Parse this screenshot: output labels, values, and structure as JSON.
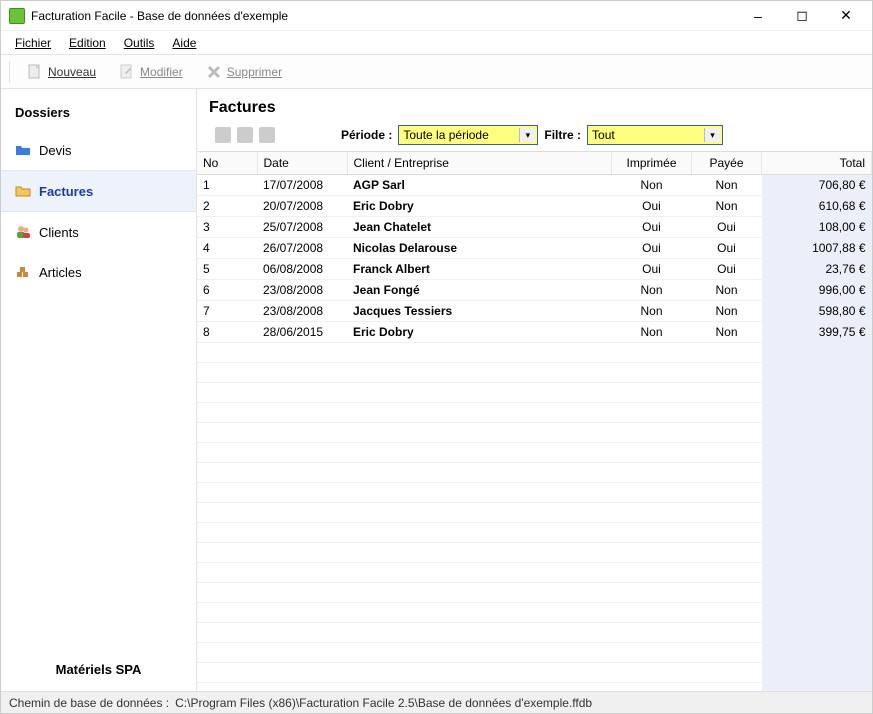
{
  "window": {
    "title": "Facturation Facile - Base de données d'exemple"
  },
  "menu": {
    "file": "Fichier",
    "edit": "Edition",
    "tools": "Outils",
    "help": "Aide"
  },
  "toolbar": {
    "new": "Nouveau",
    "modify": "Modifier",
    "delete": "Supprimer"
  },
  "sidebar": {
    "header": "Dossiers",
    "items": [
      {
        "label": "Devis"
      },
      {
        "label": "Factures"
      },
      {
        "label": "Clients"
      },
      {
        "label": "Articles"
      }
    ],
    "footer": "Matériels SPA"
  },
  "content": {
    "title": "Factures",
    "period_label": "Période :",
    "period_value": "Toute la période",
    "filter_label": "Filtre :",
    "filter_value": "Tout"
  },
  "table": {
    "columns": {
      "no": "No",
      "date": "Date",
      "client": "Client / Entreprise",
      "printed": "Imprimée",
      "paid": "Payée",
      "total": "Total"
    },
    "rows": [
      {
        "no": "1",
        "date": "17/07/2008",
        "client": "AGP Sarl",
        "printed": "Non",
        "paid": "Non",
        "total": "706,80 €"
      },
      {
        "no": "2",
        "date": "20/07/2008",
        "client": "Eric Dobry",
        "printed": "Oui",
        "paid": "Non",
        "total": "610,68 €"
      },
      {
        "no": "3",
        "date": "25/07/2008",
        "client": "Jean Chatelet",
        "printed": "Oui",
        "paid": "Oui",
        "total": "108,00 €"
      },
      {
        "no": "4",
        "date": "26/07/2008",
        "client": "Nicolas Delarouse",
        "printed": "Oui",
        "paid": "Oui",
        "total": "1007,88 €"
      },
      {
        "no": "5",
        "date": "06/08/2008",
        "client": "Franck Albert",
        "printed": "Oui",
        "paid": "Oui",
        "total": "23,76 €"
      },
      {
        "no": "6",
        "date": "23/08/2008",
        "client": "Jean Fongé",
        "printed": "Non",
        "paid": "Non",
        "total": "996,00 €"
      },
      {
        "no": "7",
        "date": "23/08/2008",
        "client": "Jacques Tessiers",
        "printed": "Non",
        "paid": "Non",
        "total": "598,80 €"
      },
      {
        "no": "8",
        "date": "28/06/2015",
        "client": "Eric Dobry",
        "printed": "Non",
        "paid": "Non",
        "total": "399,75 €"
      }
    ]
  },
  "statusbar": {
    "label": "Chemin de base de données :",
    "path": "C:\\Program Files (x86)\\Facturation Facile 2.5\\Base de données d'exemple.ffdb"
  }
}
